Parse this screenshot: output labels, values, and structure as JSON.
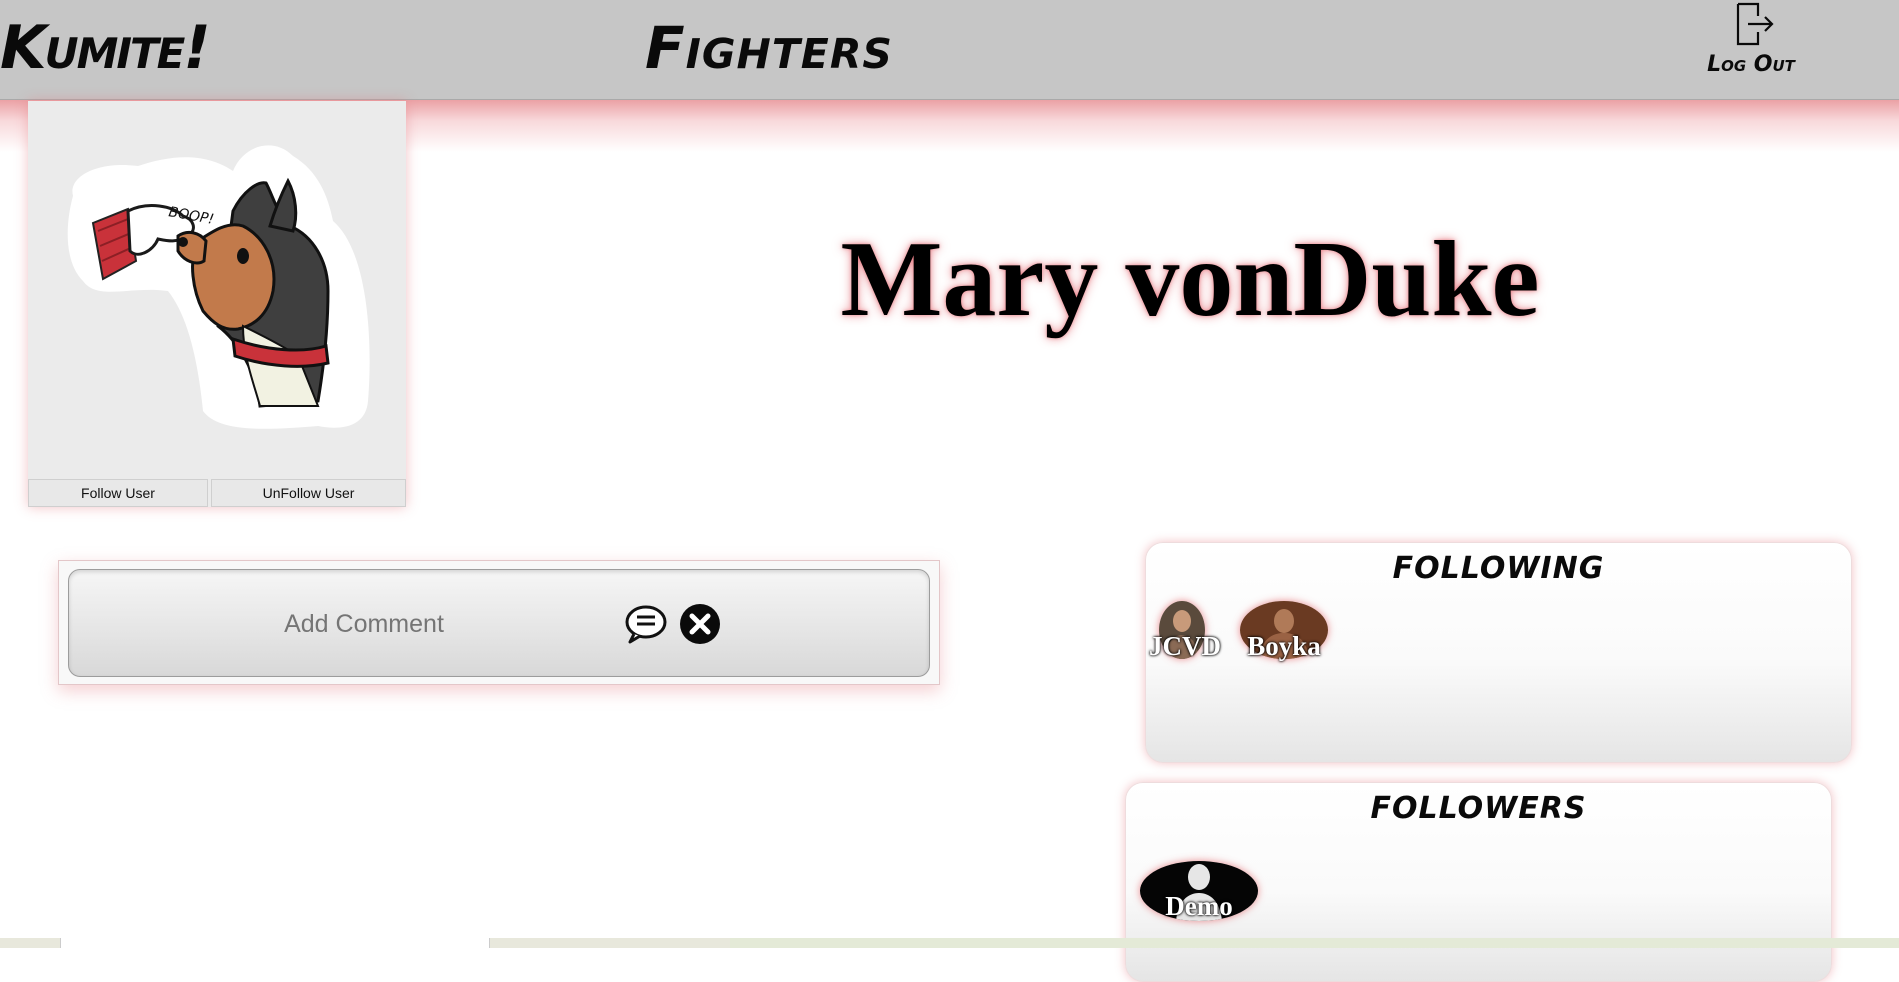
{
  "nav": {
    "brand": "Kumite!",
    "fighters_link": "Fighters",
    "logout_label": "Log Out",
    "logout_icon": "logout-icon"
  },
  "profile": {
    "name": "Mary vonDuke",
    "avatar_icon": "dog-boop-sticker",
    "follow_label": "Follow User",
    "unfollow_label": "UnFollow User"
  },
  "comment": {
    "placeholder": "Add Comment",
    "submit_icon": "speech-bubble-icon",
    "cancel_icon": "close-circle-icon"
  },
  "following": {
    "title": "FOLLOWING",
    "users": [
      {
        "name": "JCVD"
      },
      {
        "name": "Boyka"
      }
    ]
  },
  "followers": {
    "title": "FOLLOWERS",
    "users": [
      {
        "name": "Demo"
      }
    ]
  },
  "colors": {
    "nav_bg": "#c6c6c6",
    "accent_glow": "#e2787e"
  }
}
